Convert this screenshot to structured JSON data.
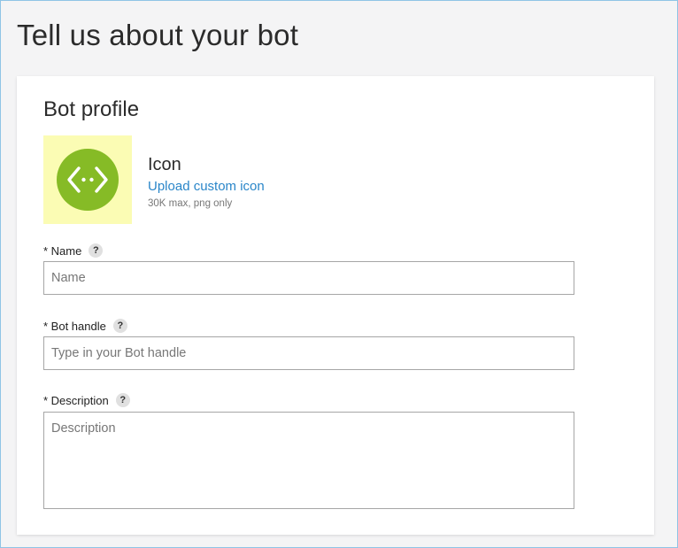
{
  "page": {
    "title": "Tell us about your bot"
  },
  "profile": {
    "section_title": "Bot profile",
    "icon": {
      "heading": "Icon",
      "upload_link": "Upload custom icon",
      "hint": "30K max, png only",
      "glyph": "code-brackets-icon",
      "tile_color": "#fbfcb4",
      "circle_color": "#86bb26"
    },
    "fields": {
      "name": {
        "label": "* Name",
        "help": "?",
        "placeholder": "Name",
        "value": ""
      },
      "handle": {
        "label": "* Bot handle",
        "help": "?",
        "placeholder": "Type in your Bot handle",
        "value": ""
      },
      "description": {
        "label": "* Description",
        "help": "?",
        "placeholder": "Description",
        "value": ""
      }
    }
  },
  "colors": {
    "link": "#2a86c9",
    "accent": "#86bb26"
  }
}
